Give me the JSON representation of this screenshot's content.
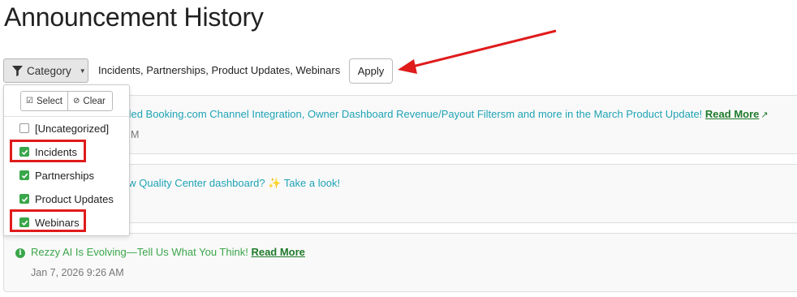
{
  "page": {
    "title": "Announcement History"
  },
  "filter": {
    "category_label": "Category",
    "selected_summary": "Incidents, Partnerships, Product Updates, Webinars",
    "apply_label": "Apply"
  },
  "dropdown": {
    "select_label": "Select",
    "clear_label": "Clear",
    "options": [
      {
        "label": "[Uncategorized]",
        "checked": false
      },
      {
        "label": "Incidents",
        "checked": true
      },
      {
        "label": "Partnerships",
        "checked": true
      },
      {
        "label": "Product Updates",
        "checked": true
      },
      {
        "label": "Webinars",
        "checked": true
      }
    ]
  },
  "announcements": [
    {
      "visible_text": "nded Booking.com Channel Integration, Owner Dashboard Revenue/Payout Filtersm and more in the March Product Update!",
      "link": "Read More",
      "date_visible": "M"
    },
    {
      "visible_text": "ew Quality Center dashboard? ✨ Take a look!",
      "date_visible": ""
    },
    {
      "visible_text": "Rezzy AI Is Evolving—Tell Us What You Think!",
      "link": "Read More",
      "date_visible": "Jan 7, 2026 9:26 AM"
    }
  ],
  "colors": {
    "accent_teal": "#1fa3b5",
    "accent_green": "#3aa64a",
    "link_green": "#1f7a2b",
    "highlight_red": "#e01b1b"
  }
}
